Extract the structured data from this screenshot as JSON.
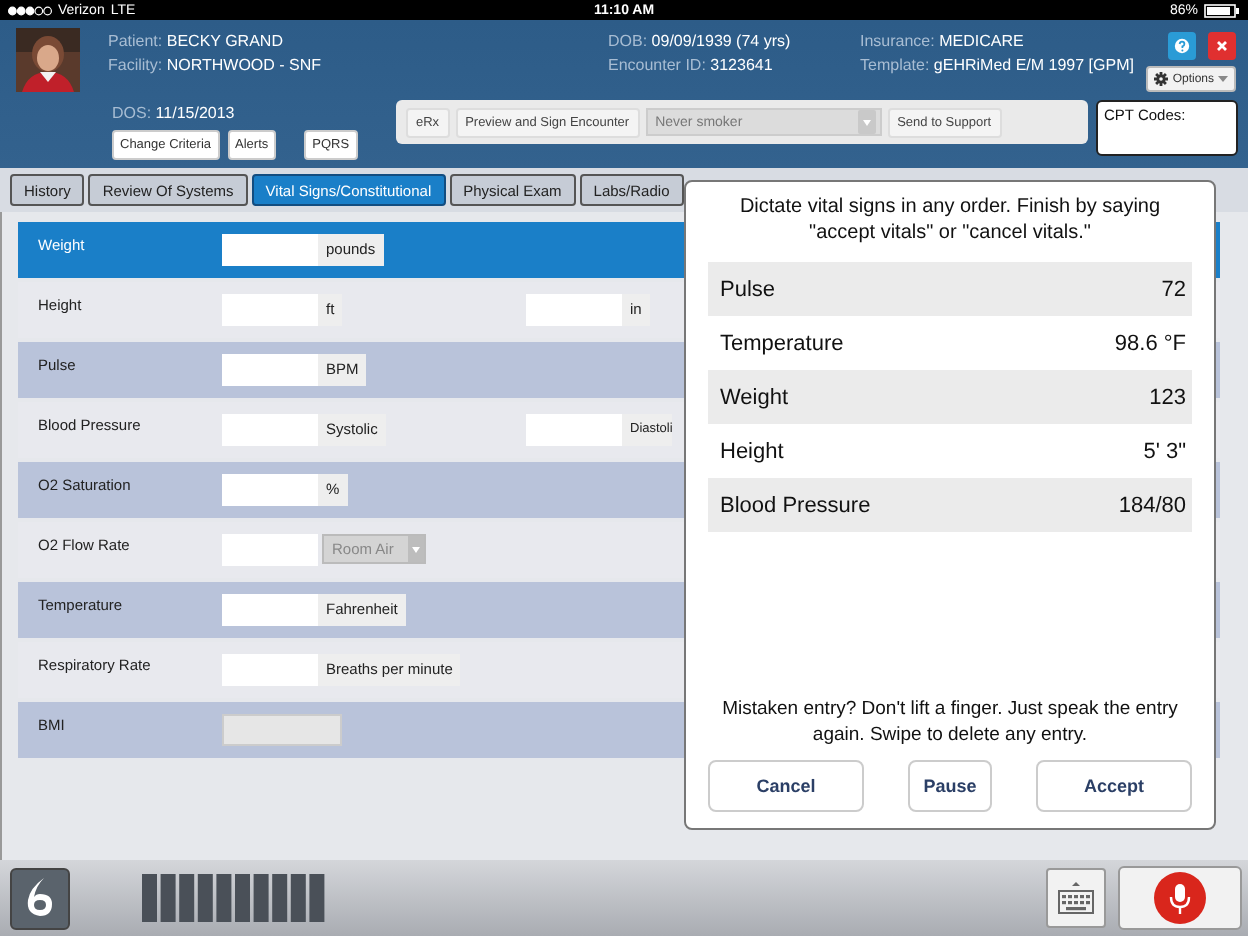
{
  "status_bar": {
    "carrier": "Verizon",
    "network": "LTE",
    "time": "11:10 AM",
    "battery": "86%"
  },
  "header": {
    "info_columns": [
      {
        "fields": [
          {
            "label": "Patient:",
            "value": "BECKY GRAND"
          },
          {
            "label": "Facility:",
            "value": "NORTHWOOD - SNF"
          }
        ]
      },
      {
        "fields": [
          {
            "label": "DOB:",
            "value": "09/09/1939 (74 yrs)"
          },
          {
            "label": "Encounter ID:",
            "value": "3123641"
          }
        ]
      },
      {
        "fields": [
          {
            "label": "Insurance:",
            "value": "MEDICARE"
          },
          {
            "label": "Template:",
            "value": "gEHRiMed E/M 1997 [GPM]"
          }
        ]
      }
    ],
    "options_button": "Options",
    "dos": {
      "label": "DOS:",
      "value": "11/15/2013"
    },
    "buttons": [
      "Change Criteria",
      "Alerts",
      "PQRS"
    ],
    "toolbar": {
      "buttons": [
        "eRx",
        "Preview and Sign Encounter"
      ],
      "smoking_select": "Never smoker",
      "send_button": "Send to Support"
    },
    "cpt_box": {
      "label": "CPT Codes:"
    }
  },
  "tabs": [
    {
      "label": "History",
      "selected": false
    },
    {
      "label": "Review Of Systems",
      "selected": false
    },
    {
      "label": "Vital Signs/Constitutional",
      "selected": true
    },
    {
      "label": "Physical Exam",
      "selected": false
    },
    {
      "label": "Labs/Radio",
      "selected": false
    }
  ],
  "vitals_rows": [
    {
      "label": "Weight",
      "selected": true,
      "kind": "input",
      "unit": "pounds"
    },
    {
      "label": "Height",
      "selected": false,
      "kind": "input",
      "unit": "ft",
      "second_unit": "in"
    },
    {
      "label": "Pulse",
      "selected": false,
      "kind": "input",
      "unit": "BPM"
    },
    {
      "label": "Blood Pressure",
      "selected": false,
      "kind": "input",
      "unit": "Systolic",
      "second_unit": "Diastoli"
    },
    {
      "label": "O2 Saturation",
      "selected": false,
      "kind": "input",
      "unit": "%"
    },
    {
      "label": "O2 Flow Rate",
      "selected": false,
      "kind": "select",
      "select_value": "Room Air"
    },
    {
      "label": "Temperature",
      "selected": false,
      "kind": "input",
      "unit": "Fahrenheit"
    },
    {
      "label": "Respiratory Rate",
      "selected": false,
      "kind": "input",
      "unit": "Breaths per minute"
    },
    {
      "label": "BMI",
      "selected": false,
      "kind": "readonly"
    }
  ],
  "dictation_popup": {
    "instruction": "Dictate vital signs in any order. Finish by saying \"accept vitals\" or \"cancel vitals.\"",
    "entries": [
      {
        "label": "Pulse",
        "value": "72"
      },
      {
        "label": "Temperature",
        "value": "98.6 °F"
      },
      {
        "label": "Weight",
        "value": "123"
      },
      {
        "label": "Height",
        "value": "5' 3\""
      },
      {
        "label": "Blood Pressure",
        "value": "184/80"
      }
    ],
    "hint": "Mistaken entry? Don't lift a finger. Just speak the entry again. Swipe to delete any entry.",
    "buttons": [
      "Cancel",
      "Pause",
      "Accept"
    ]
  }
}
